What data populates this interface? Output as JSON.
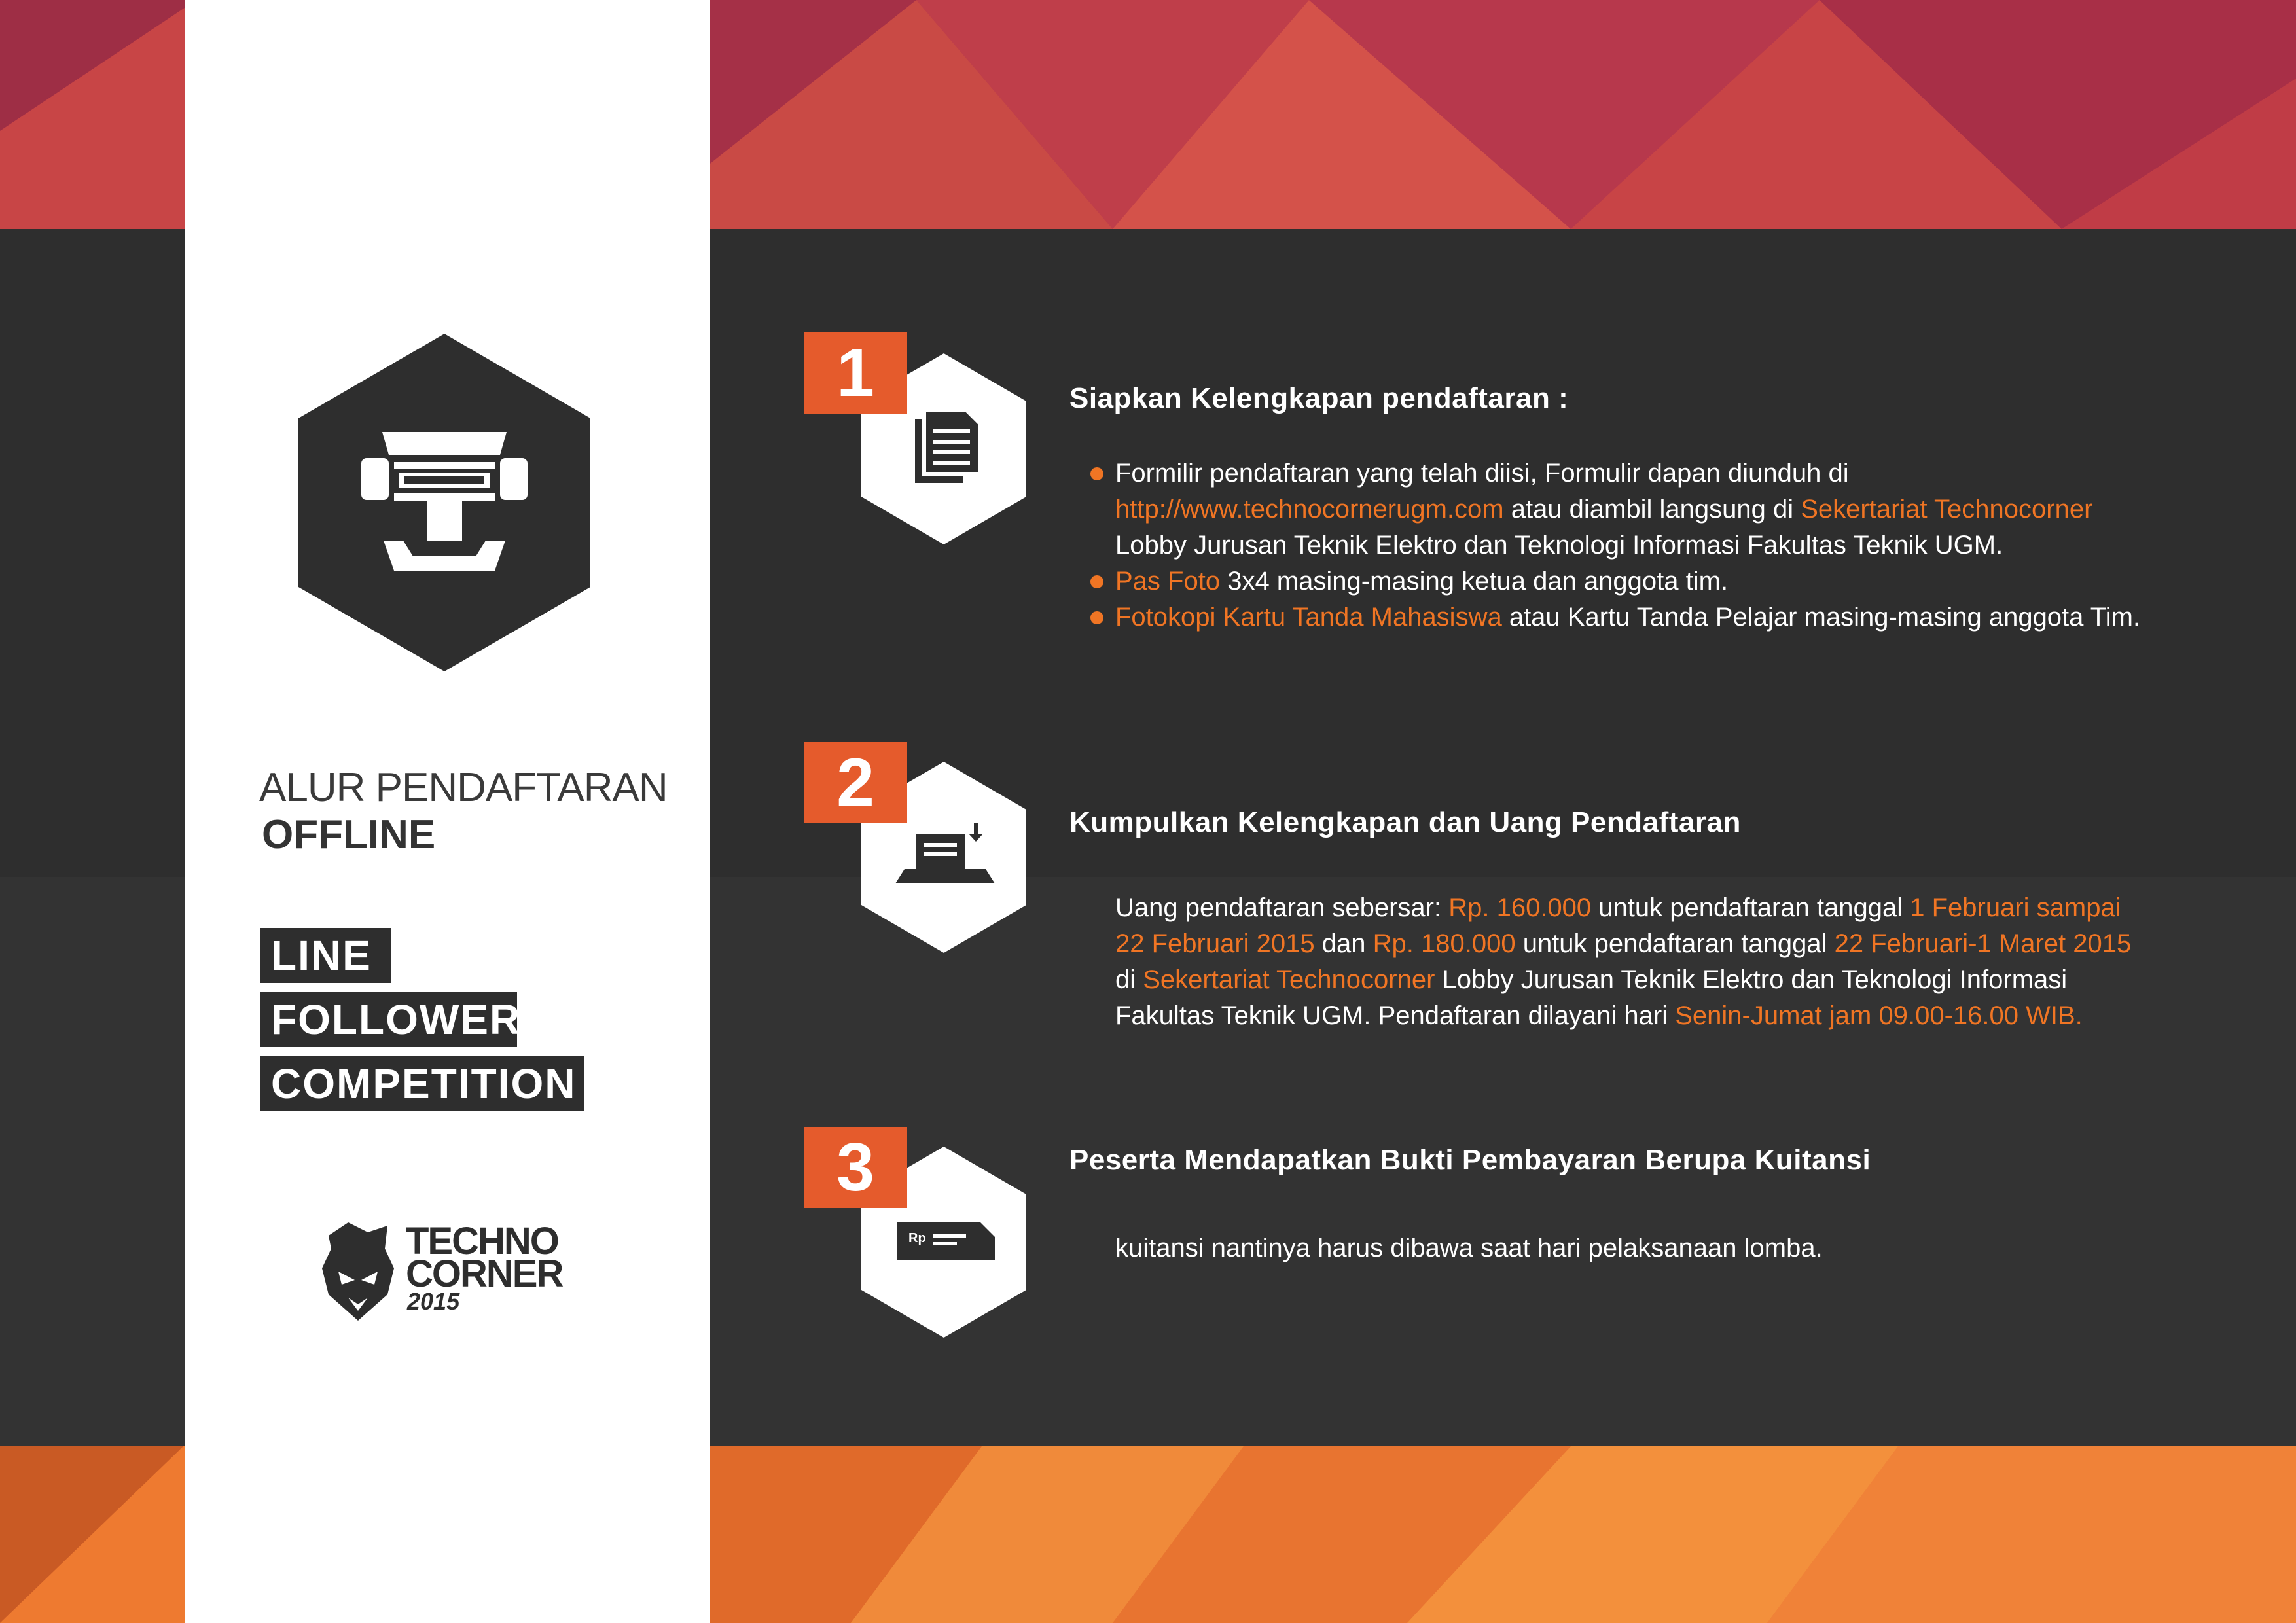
{
  "colors": {
    "accent": "#e55b2c",
    "highlight": "#f07524",
    "dark": "#2e2e2e",
    "panel": "#ffffff"
  },
  "sidebar": {
    "emblem_icon": "robot-hexagon-icon",
    "title_line1": "ALUR PENDAFTARAN",
    "title_line2": "OFFLINE",
    "tags": [
      "LINE",
      "FOLLOWER",
      "COMPETITION"
    ],
    "brand": {
      "line1": "TECHNO",
      "line2": "CORNER",
      "year": "2015",
      "icon": "panther-head-icon"
    }
  },
  "steps": [
    {
      "number": "1",
      "icon": "document-copy-icon",
      "title": "Siapkan Kelengkapan pendaftaran :",
      "bullets": {
        "b1_l1": "Formilir pendaftaran yang telah diisi, Formulir dapan diunduh di",
        "b1_link": "http://www.technocornerugm.com",
        "b1_mid": " atau diambil langsung di ",
        "b1_place": "Sekertariat Technocorner",
        "b1_l3": "Lobby Jurusan Teknik Elektro dan Teknologi Informasi Fakultas Teknik UGM.",
        "b2_hl": "Pas Foto",
        "b2_rest": " 3x4 masing-masing ketua dan anggota tim.",
        "b3_hl": "Fotokopi Kartu Tanda Mahasiswa",
        "b3_rest": " atau Kartu Tanda Pelajar masing-masing anggota Tim."
      }
    },
    {
      "number": "2",
      "icon": "submit-tray-icon",
      "title": "Kumpulkan Kelengkapan dan Uang Pendaftaran",
      "body": {
        "t1": "Uang pendaftaran sebersar: ",
        "h1": "Rp. 160.000",
        "t2": " untuk pendaftaran tanggal ",
        "h2a": "1 Februari sampai",
        "h2b": "22 Februari 2015",
        "t3": " dan ",
        "h3": "Rp. 180.000",
        "t4": " untuk pendaftaran tanggal ",
        "h4": "22 Februari-1 Maret 2015",
        "t5": "di ",
        "h5": "Sekertariat Technocorner",
        "t6": " Lobby Jurusan Teknik Elektro dan Teknologi Informasi",
        "t7": "Fakultas Teknik UGM. Pendaftaran dilayani hari ",
        "h7": "Senin-Jumat jam 09.00-16.00 WIB."
      }
    },
    {
      "number": "3",
      "icon": "receipt-icon",
      "icon_label": "Rp",
      "title": "Peserta Mendapatkan Bukti Pembayaran Berupa Kuitansi",
      "body": {
        "t1": "kuitansi nantinya harus dibawa saat hari pelaksanaan lomba."
      }
    }
  ]
}
